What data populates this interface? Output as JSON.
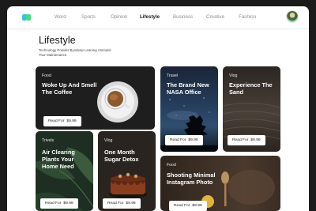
{
  "nav": {
    "items": [
      {
        "label": "Word"
      },
      {
        "label": "Sports"
      },
      {
        "label": "Opinion"
      },
      {
        "label": "Lifestyle",
        "active": true
      },
      {
        "label": "Business"
      },
      {
        "label": "Creative"
      },
      {
        "label": "Fashion"
      }
    ]
  },
  "page": {
    "title": "Lifestyle",
    "subtitle": "Technology Powder Byndeep Leaning Atomatic Your Maintenance."
  },
  "cards": [
    {
      "id": "coffee",
      "tag": "Food",
      "title": "Woke Up And Smell The Coffee",
      "read_label": "Read For",
      "price": "$9.99"
    },
    {
      "id": "nasa",
      "tag": "Travel",
      "title": "The Brand New NASA Office",
      "read_label": "Read For",
      "price": "$9.99"
    },
    {
      "id": "sand",
      "tag": "Vlog",
      "title": "Experience The Sand",
      "read_label": "Read For",
      "price": "$9.99"
    },
    {
      "id": "plants",
      "tag": "Trivels",
      "title": "Air Clearing Plants Your Home Need",
      "read_label": "Read For",
      "price": "$9.99"
    },
    {
      "id": "sugar",
      "tag": "Vlog",
      "title": "One Month Sugar Detox",
      "read_label": "Read For",
      "price": "$9.99"
    },
    {
      "id": "instagram",
      "tag": "Food",
      "title": "Shooting Minimal Instagram Photo",
      "read_label": "Read For",
      "price": "$9.99"
    }
  ],
  "colors": {
    "page_bg": "#ffffff",
    "backdrop": "#1b1b1b",
    "active_nav": "#1a1a1a",
    "nav": "#8f8f8f"
  }
}
